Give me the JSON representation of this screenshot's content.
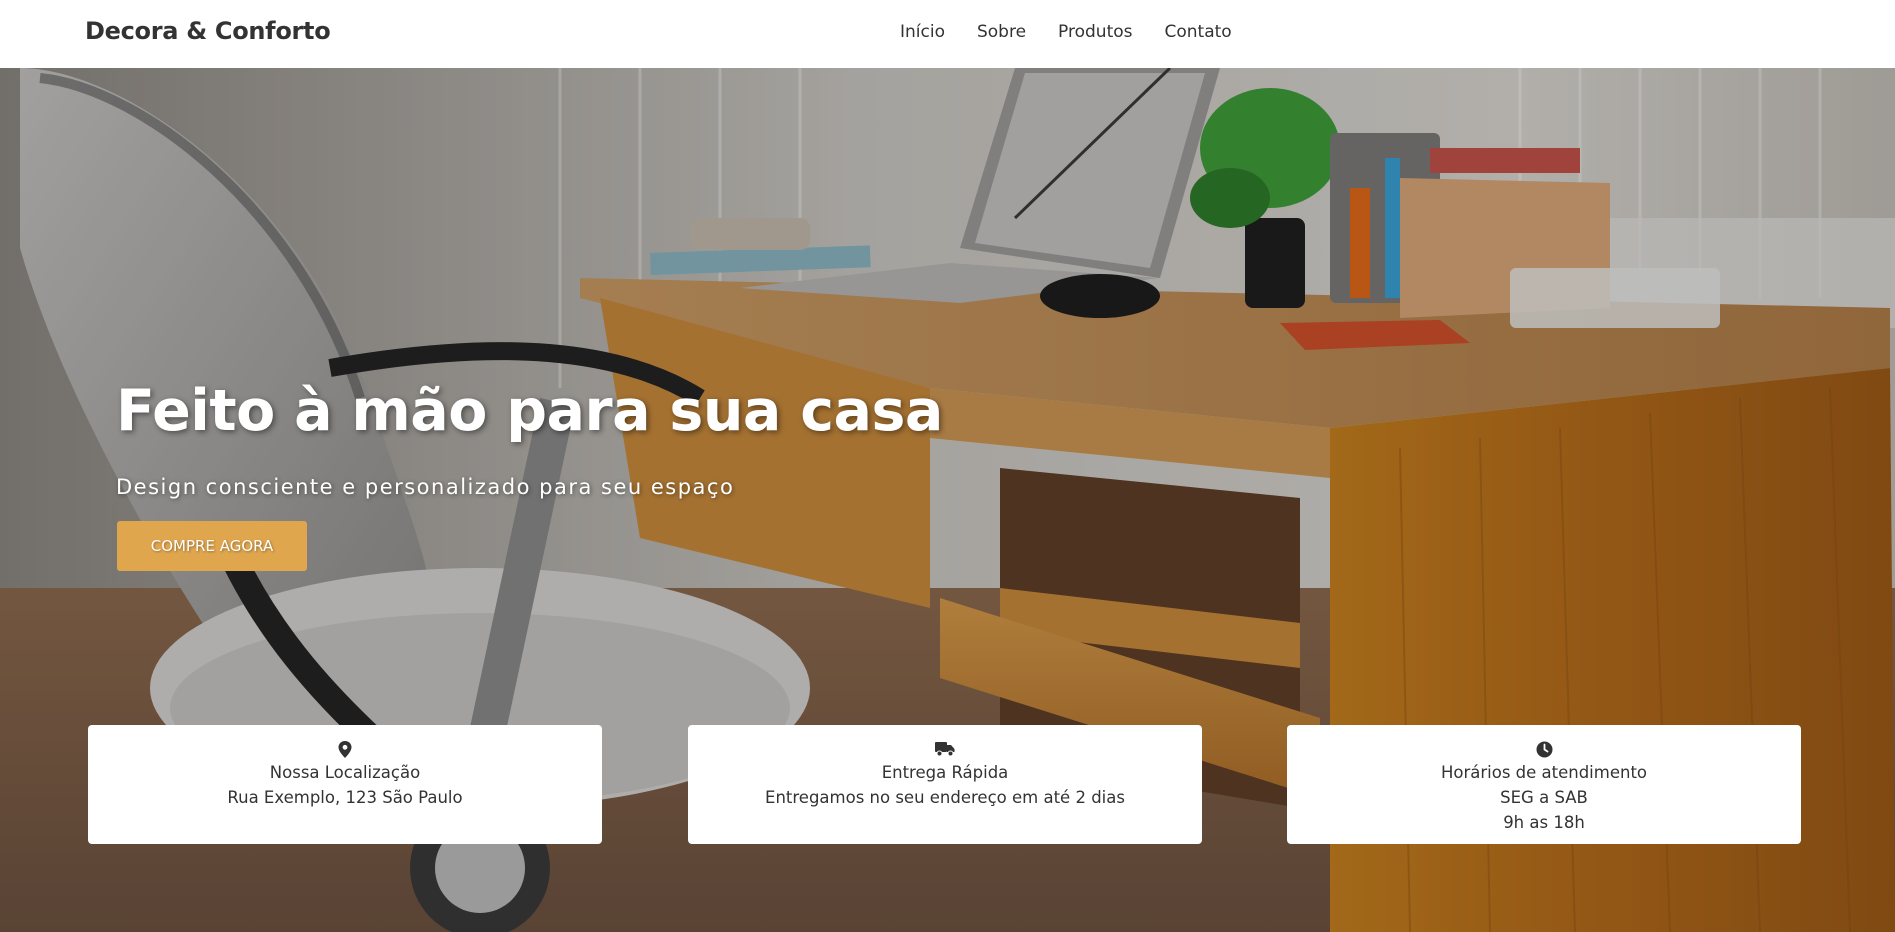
{
  "header": {
    "brand": "Decora & Conforto",
    "nav": [
      {
        "label": "Início"
      },
      {
        "label": "Sobre"
      },
      {
        "label": "Produtos"
      },
      {
        "label": "Contato"
      }
    ]
  },
  "hero": {
    "title": "Feito à mão para sua casa",
    "subtitle": "Design consciente e personalizado para seu espaço",
    "cta_label": "COMPRE AGORA",
    "image_description_icon": "office-desk-photo"
  },
  "cards": [
    {
      "icon": "location-pin-icon",
      "title": "Nossa Localização",
      "lines": [
        "Rua Exemplo, 123 São Paulo"
      ]
    },
    {
      "icon": "truck-icon",
      "title": "Entrega Rápida",
      "lines": [
        "Entregamos no seu endereço em até 2 dias"
      ]
    },
    {
      "icon": "clock-icon",
      "title": "Horários de atendimento",
      "lines": [
        "SEG a SAB",
        "9h as 18h"
      ]
    }
  ],
  "colors": {
    "accent": "#e0a64e",
    "text": "#333333",
    "header_bg": "#ffffff"
  }
}
